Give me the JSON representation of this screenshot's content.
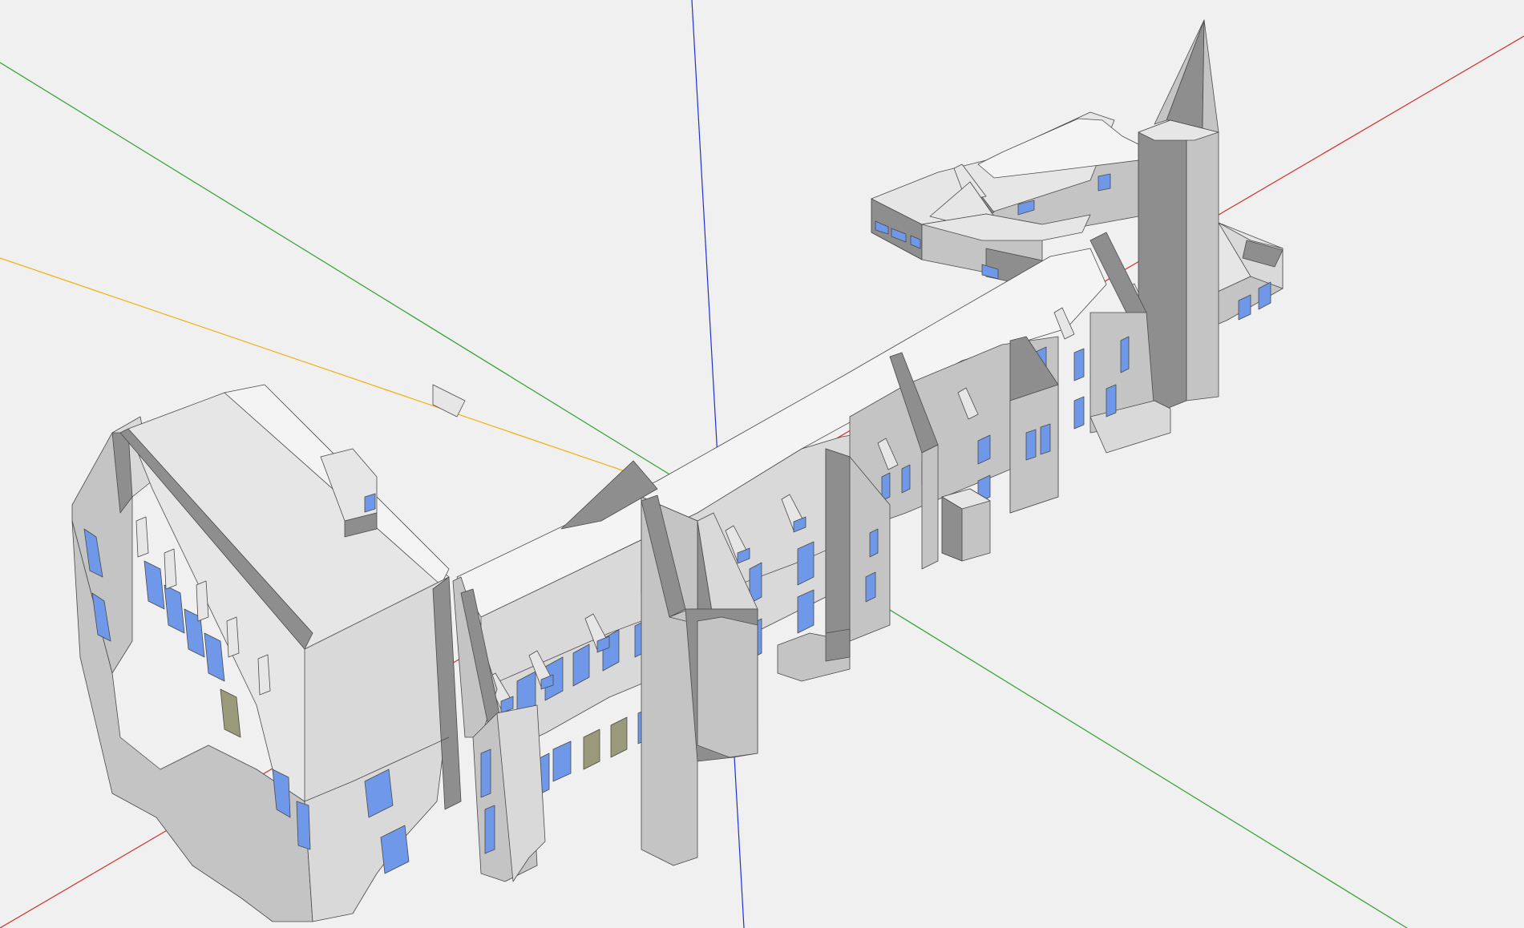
{
  "scene": {
    "background": "#f0f0f0",
    "model_name": "building-model",
    "axes": {
      "x_axis_color": "#d23030",
      "y_axis_color": "#30a030",
      "z_axis_color": "#2030d0",
      "guide_line_color": "#f0b010"
    },
    "colors": {
      "roof_light": "#e6e6e6",
      "roof_white": "#f4f4f4",
      "wall_light": "#d9d9d9",
      "wall_mid": "#c4c4c4",
      "wall_dark": "#8e8e8e",
      "wall_shadow": "#7a7a7a",
      "glass": "#6f98e8",
      "glass_dim": "#9a9a7a",
      "edge": "#4a4a4a"
    }
  }
}
